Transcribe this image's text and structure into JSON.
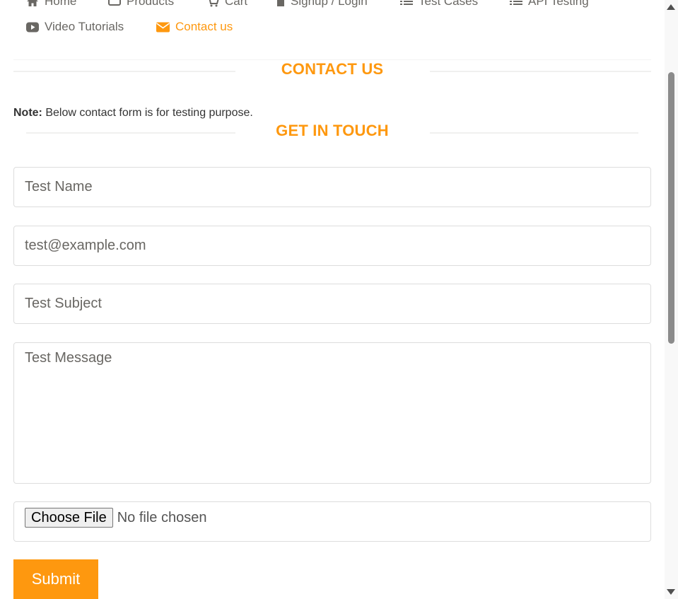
{
  "nav": {
    "items": [
      {
        "label": "Home",
        "icon": "home-icon"
      },
      {
        "label": "Products",
        "icon": "products-icon"
      },
      {
        "label": "Cart",
        "icon": "cart-icon"
      },
      {
        "label": "Signup / Login",
        "icon": "lock-icon"
      },
      {
        "label": "Test Cases",
        "icon": "list-icon"
      },
      {
        "label": "API Testing",
        "icon": "list-icon"
      },
      {
        "label": "Video Tutorials",
        "icon": "youtube-icon"
      },
      {
        "label": "Contact us",
        "icon": "envelope-icon",
        "active": true
      }
    ]
  },
  "page": {
    "title": "CONTACT US",
    "note_label": "Note:",
    "note_text": " Below contact form is for testing purpose.",
    "form_title": "GET IN TOUCH"
  },
  "form": {
    "name_value": "Test Name",
    "email_value": "test@example.com",
    "subject_value": "Test Subject",
    "message_value": "Test Message",
    "file_button_label": "Choose File",
    "file_status": "No file chosen",
    "submit_label": "Submit"
  },
  "colors": {
    "accent": "#FE980F",
    "nav_text": "#696763"
  }
}
